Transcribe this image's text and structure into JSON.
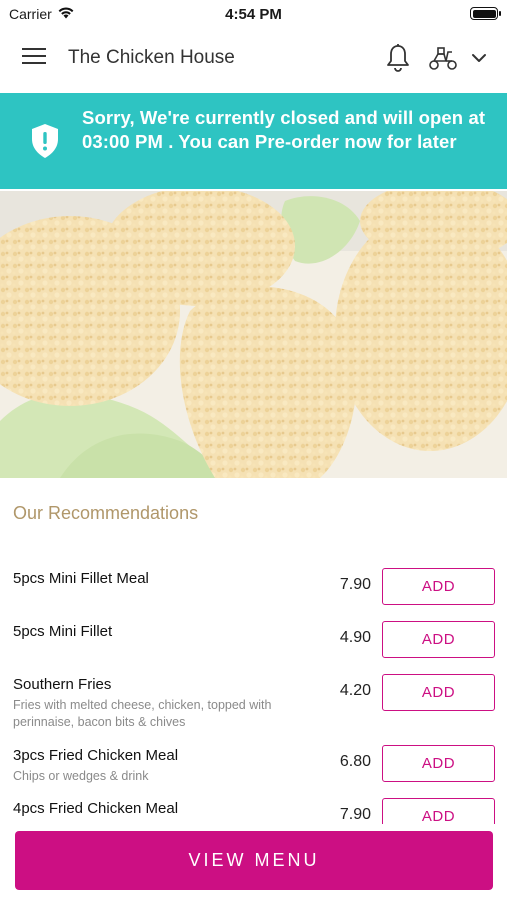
{
  "status_bar": {
    "carrier": "Carrier",
    "time": "4:54 PM"
  },
  "header": {
    "title": "The Chicken House"
  },
  "banner": {
    "message": "Sorry, We're currently closed and will open at 03:00 PM . You can Pre-order now for later"
  },
  "hero": {
    "image": "fried-chicken-photo"
  },
  "recommendations": {
    "title": "Our Recommendations",
    "items": [
      {
        "name": "5pcs Mini Fillet Meal",
        "description": "",
        "price": "7.90",
        "action": "ADD"
      },
      {
        "name": "5pcs Mini Fillet",
        "description": "",
        "price": "4.90",
        "action": "ADD"
      },
      {
        "name": "Southern Fries",
        "description": "Fries with melted cheese, chicken, topped with perinnaise, bacon bits & chives",
        "price": "4.20",
        "action": "ADD"
      },
      {
        "name": "3pcs Fried Chicken Meal",
        "description": "Chips or wedges & drink",
        "price": "6.80",
        "action": "ADD"
      },
      {
        "name": "4pcs Fried Chicken Meal",
        "description": "",
        "price": "7.90",
        "action": "ADD"
      }
    ]
  },
  "footer": {
    "view_menu_label": "VIEW MENU"
  },
  "colors": {
    "accent": "#cc0f83",
    "banner": "#2ec4c2",
    "section_title": "#b0976a"
  },
  "icons": [
    "wifi-icon",
    "battery-icon",
    "hamburger-menu-icon",
    "bell-icon",
    "delivery-scooter-icon",
    "chevron-down-icon",
    "shield-icon"
  ]
}
